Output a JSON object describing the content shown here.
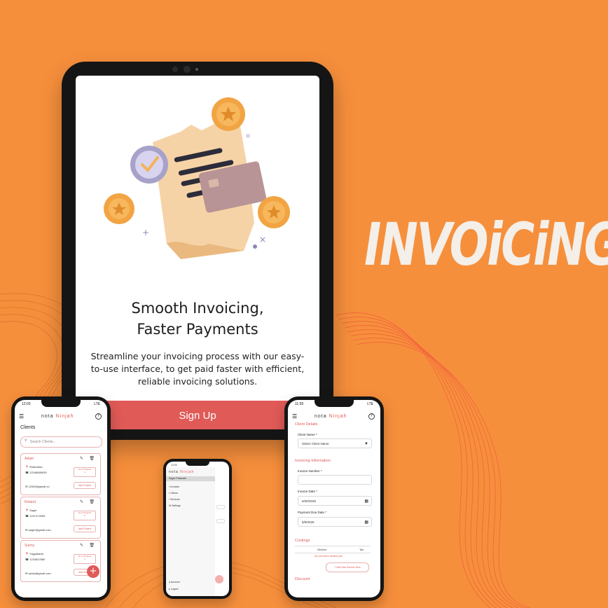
{
  "headline_word": "INVOiCiNG",
  "tablet": {
    "title": "Smooth Invoicing,\nFaster Payments",
    "subtitle": "Streamline your invoicing process with our easy-to-use interface, to get paid faster with efficient, reliable invoicing solutions.",
    "signup_label": "Sign Up"
  },
  "left_phone": {
    "time": "12:03",
    "network": "LTE",
    "brand_a": "nota",
    "brand_b": "Ninjah",
    "page_title": "Clients",
    "search_placeholder": "Search Clients...",
    "clients": [
      {
        "name": "Adam",
        "address": "Rotterdam",
        "phone": "12348585939",
        "email": "12345@gmail.co",
        "projects_label": "No of Projects",
        "projects": "0",
        "add_label": "Add Project"
      },
      {
        "name": "Roland",
        "address": "Sager",
        "phone": "1247474959",
        "email": "sager@gmail.com",
        "projects_label": "No of Projects",
        "projects": "0",
        "add_label": "Add Project"
      },
      {
        "name": "Sunny",
        "address": "Yogyakarta",
        "phone": "1234547880",
        "email": "sylvia@gmail.com",
        "projects_label": "No of Projects",
        "projects": "3",
        "add_label": "Add Project"
      }
    ],
    "fab": "+"
  },
  "middle_phone": {
    "time": "12:03",
    "brand_a": "nota",
    "brand_b": "Ninjah",
    "user": "Sagar Pattanaik",
    "menu": [
      "Invoices",
      "Clients",
      "Services",
      "Settings"
    ],
    "footer": [
      "Account",
      "Logout"
    ]
  },
  "right_phone": {
    "time": "11:59",
    "brand_a": "nota",
    "brand_b": "Ninjah",
    "client_details": "Client Details",
    "client_name_label": "Client Name *",
    "client_name_value": "Select Client Name",
    "invoice_info": "Invoicing Information",
    "invoice_number_label": "Invoice Number *",
    "invoice_number_value": "",
    "invoice_date_label": "Invoice Date *",
    "invoice_date_value": "6/30/2025",
    "due_date_label": "Payment Due Date *",
    "due_date_value": "5/9/2025",
    "costings": "Costings",
    "col_service": "Service",
    "col_tax": "Tax",
    "no_services": "No services added yet",
    "add_service": "+ Add New Service Item",
    "discount": "Discount"
  },
  "colors": {
    "background": "#f68f3c",
    "accent": "#e05a57",
    "device": "#151515"
  }
}
